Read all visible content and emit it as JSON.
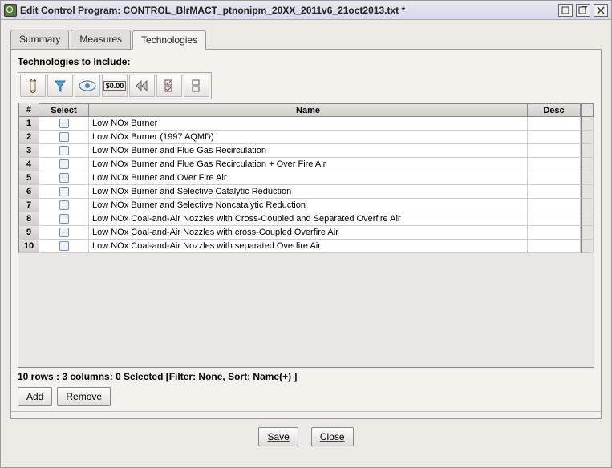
{
  "window": {
    "title": "Edit Control Program: CONTROL_BlrMACT_ptnonipm_20XX_2011v6_21oct2013.txt *"
  },
  "tabs": [
    {
      "label": "Summary",
      "active": false
    },
    {
      "label": "Measures",
      "active": false
    },
    {
      "label": "Technologies",
      "active": true
    }
  ],
  "section_label": "Technologies to Include:",
  "toolbar": {
    "icons": [
      "sort-icon",
      "filter-icon",
      "view-icon",
      "format-icon",
      "reset-icon",
      "select-all-icon",
      "deselect-all-icon"
    ]
  },
  "table": {
    "columns": [
      "#",
      "Select",
      "Name",
      "Desc"
    ],
    "rows": [
      {
        "n": "1",
        "name": "Low NOx Burner",
        "desc": ""
      },
      {
        "n": "2",
        "name": "Low NOx Burner (1997 AQMD)",
        "desc": ""
      },
      {
        "n": "3",
        "name": "Low NOx Burner and Flue Gas Recirculation",
        "desc": ""
      },
      {
        "n": "4",
        "name": "Low NOx Burner and Flue Gas Recirculation + Over Fire Air",
        "desc": ""
      },
      {
        "n": "5",
        "name": "Low NOx Burner and Over Fire Air",
        "desc": ""
      },
      {
        "n": "6",
        "name": "Low NOx Burner and Selective Catalytic Reduction",
        "desc": ""
      },
      {
        "n": "7",
        "name": "Low NOx Burner and Selective Noncatalytic Reduction",
        "desc": ""
      },
      {
        "n": "8",
        "name": "Low NOx Coal-and-Air Nozzles with Cross-Coupled and Separated Overfire Air",
        "desc": ""
      },
      {
        "n": "9",
        "name": "Low NOx Coal-and-Air Nozzles with cross-Coupled Overfire Air",
        "desc": ""
      },
      {
        "n": "10",
        "name": "Low NOx Coal-and-Air Nozzles with separated Overfire Air",
        "desc": ""
      }
    ]
  },
  "status": "10 rows : 3 columns: 0 Selected [Filter: None, Sort: Name(+) ]",
  "buttons": {
    "add": "Add",
    "remove": "Remove",
    "save": "Save",
    "close": "Close"
  }
}
